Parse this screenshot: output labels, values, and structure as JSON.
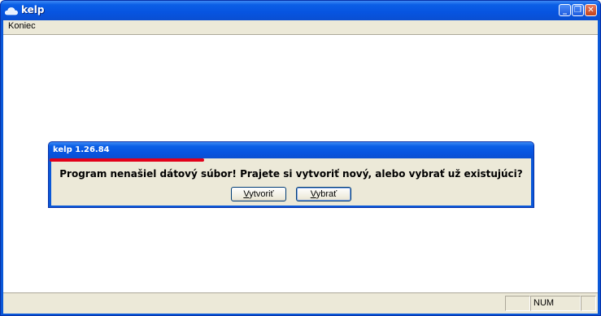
{
  "window": {
    "title": "kelp",
    "controls": [
      "minimize-icon",
      "restore-icon",
      "close-icon"
    ]
  },
  "menu": {
    "items": [
      {
        "label": "Koniec"
      }
    ]
  },
  "dialog": {
    "title": "kelp 1.26.84",
    "message": "Program nenašiel dátový súbor! Prajete si vytvoriť nový, alebo vybrať už existujúci?",
    "buttons": [
      {
        "mnemonic": "V",
        "rest": "ytvoriť"
      },
      {
        "mnemonic": "V",
        "rest": "ybrať"
      }
    ]
  },
  "statusbar": {
    "panels": [
      "",
      "NUM",
      ""
    ]
  },
  "colors": {
    "titlebar": "#0a58d8",
    "face": "#ece9d8",
    "accent_red": "#e2001a"
  }
}
